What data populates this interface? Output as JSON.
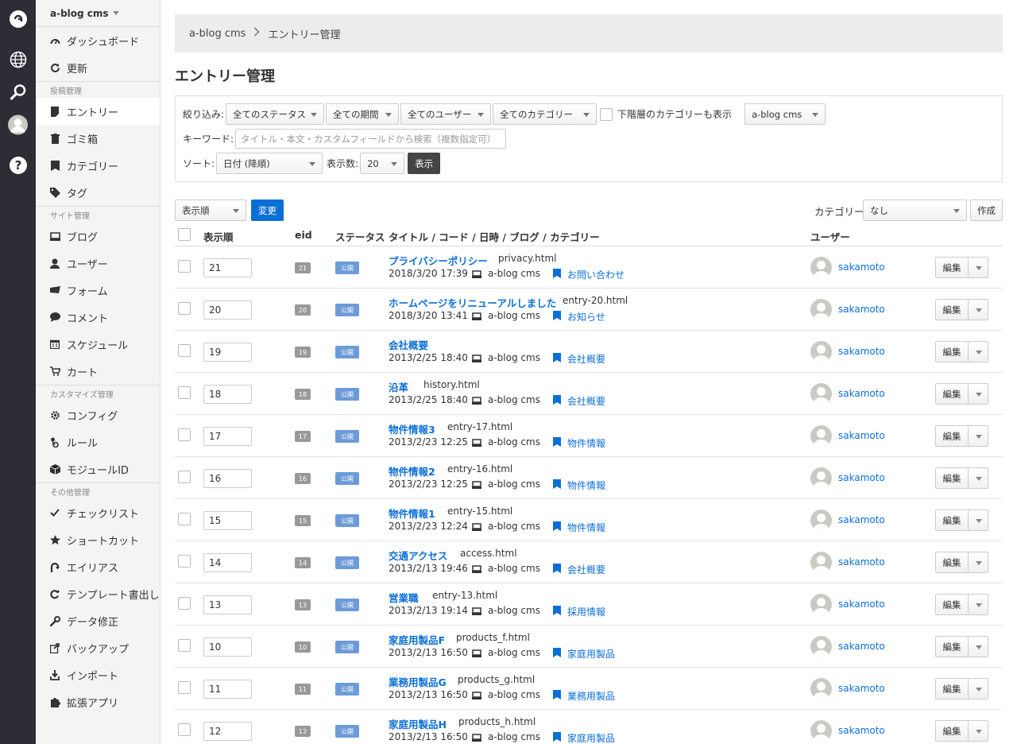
{
  "sidebar": {
    "site_name": "a-blog cms",
    "items_top": [
      {
        "label": "ダッシュボード",
        "icon": "dashboard-icon"
      },
      {
        "label": "更新",
        "icon": "refresh-icon"
      }
    ],
    "sections": [
      {
        "title": "投稿管理",
        "items": [
          {
            "label": "エントリー",
            "icon": "entry-icon",
            "active": true
          },
          {
            "label": "ゴミ箱",
            "icon": "trash-icon"
          },
          {
            "label": "カテゴリー",
            "icon": "category-icon"
          },
          {
            "label": "タグ",
            "icon": "tag-icon"
          }
        ]
      },
      {
        "title": "サイト管理",
        "items": [
          {
            "label": "ブログ",
            "icon": "blog-icon"
          },
          {
            "label": "ユーザー",
            "icon": "user-icon"
          },
          {
            "label": "フォーム",
            "icon": "form-icon"
          },
          {
            "label": "コメント",
            "icon": "comment-icon"
          },
          {
            "label": "スケジュール",
            "icon": "calendar-icon"
          },
          {
            "label": "カート",
            "icon": "cart-icon"
          }
        ]
      },
      {
        "title": "カスタマイズ管理",
        "items": [
          {
            "label": "コンフィグ",
            "icon": "gear-icon"
          },
          {
            "label": "ルール",
            "icon": "rule-icon"
          },
          {
            "label": "モジュールID",
            "icon": "module-icon"
          }
        ]
      },
      {
        "title": "その他管理",
        "items": [
          {
            "label": "チェックリスト",
            "icon": "check-icon"
          },
          {
            "label": "ショートカット",
            "icon": "star-icon"
          },
          {
            "label": "エイリアス",
            "icon": "alias-icon"
          },
          {
            "label": "テンプレート書出し",
            "icon": "template-icon"
          },
          {
            "label": "データ修正",
            "icon": "wrench-icon"
          },
          {
            "label": "バックアップ",
            "icon": "backup-icon"
          },
          {
            "label": "インポート",
            "icon": "import-icon"
          },
          {
            "label": "拡張アプリ",
            "icon": "puzzle-icon"
          }
        ]
      }
    ]
  },
  "breadcrumb": {
    "home": "a-blog cms",
    "current": "エントリー管理"
  },
  "page_title": "エントリー管理",
  "filter": {
    "narrow_label": "絞り込み:",
    "status": "全てのステータス",
    "period": "全ての期間",
    "user": "全てのユーザー",
    "category": "全てのカテゴリー",
    "subcat_label": "下階層のカテゴリーも表示",
    "blog": "a-blog cms",
    "keyword_label": "キーワード:",
    "keyword_placeholder": "タイトル・本文・カスタムフィールドから検索（複数指定可）",
    "sort_label": "ソート:",
    "sort": "日付 (降順)",
    "count_label": "表示数:",
    "count": "20",
    "show_button": "表示"
  },
  "actions": {
    "order_select": "表示順",
    "change_button": "変更",
    "category_label": "カテゴリー",
    "category_select": "なし",
    "create_button": "作成"
  },
  "table": {
    "headers": {
      "order": "表示順",
      "eid": "eid",
      "status": "ステータス",
      "title": "タイトル / コード / 日時 / ブログ / カテゴリー",
      "user": "ユーザー"
    },
    "edit_label": "編集",
    "rows": [
      {
        "order": "21",
        "eid": "21",
        "status": "公開",
        "title": "プライバシーポリシー",
        "code": "privacy.html",
        "date": "2018/3/20 17:39",
        "blog": "a-blog cms",
        "category": "お問い合わせ",
        "user": "sakamoto"
      },
      {
        "order": "20",
        "eid": "20",
        "status": "公開",
        "title": "ホームページをリニューアルしました",
        "code": "entry-20.html",
        "date": "2018/3/20 13:41",
        "blog": "a-blog cms",
        "category": "お知らせ",
        "user": "sakamoto"
      },
      {
        "order": "19",
        "eid": "19",
        "status": "公開",
        "title": "会社概要",
        "code": "",
        "date": "2013/2/25 18:40",
        "blog": "a-blog cms",
        "category": "会社概要",
        "user": "sakamoto"
      },
      {
        "order": "18",
        "eid": "18",
        "status": "公開",
        "title": "沿革",
        "code": "history.html",
        "date": "2013/2/25 18:40",
        "blog": "a-blog cms",
        "category": "会社概要",
        "user": "sakamoto"
      },
      {
        "order": "17",
        "eid": "17",
        "status": "公開",
        "title": "物件情報3",
        "code": "entry-17.html",
        "date": "2013/2/23 12:25",
        "blog": "a-blog cms",
        "category": "物件情報",
        "user": "sakamoto"
      },
      {
        "order": "16",
        "eid": "16",
        "status": "公開",
        "title": "物件情報2",
        "code": "entry-16.html",
        "date": "2013/2/23 12:25",
        "blog": "a-blog cms",
        "category": "物件情報",
        "user": "sakamoto"
      },
      {
        "order": "15",
        "eid": "15",
        "status": "公開",
        "title": "物件情報1",
        "code": "entry-15.html",
        "date": "2013/2/23 12:24",
        "blog": "a-blog cms",
        "category": "物件情報",
        "user": "sakamoto"
      },
      {
        "order": "14",
        "eid": "14",
        "status": "公開",
        "title": "交通アクセス",
        "code": "access.html",
        "date": "2013/2/13 19:46",
        "blog": "a-blog cms",
        "category": "会社概要",
        "user": "sakamoto"
      },
      {
        "order": "13",
        "eid": "13",
        "status": "公開",
        "title": "営業職",
        "code": "entry-13.html",
        "date": "2013/2/13 19:14",
        "blog": "a-blog cms",
        "category": "採用情報",
        "user": "sakamoto"
      },
      {
        "order": "10",
        "eid": "10",
        "status": "公開",
        "title": "家庭用製品F",
        "code": "products_f.html",
        "date": "2013/2/13 16:50",
        "blog": "a-blog cms",
        "category": "家庭用製品",
        "user": "sakamoto"
      },
      {
        "order": "11",
        "eid": "11",
        "status": "公開",
        "title": "業務用製品G",
        "code": "products_g.html",
        "date": "2013/2/13 16:50",
        "blog": "a-blog cms",
        "category": "業務用製品",
        "user": "sakamoto"
      },
      {
        "order": "12",
        "eid": "12",
        "status": "公開",
        "title": "家庭用製品H",
        "code": "products_h.html",
        "date": "2013/2/13 16:50",
        "blog": "a-blog cms",
        "category": "家庭用製品",
        "user": "sakamoto"
      }
    ]
  },
  "rail": {
    "icons": [
      "logo-icon",
      "globe-icon",
      "search-icon",
      "avatar-icon",
      "help-icon"
    ]
  },
  "colors": {
    "accent": "#0b6fd8",
    "rail": "#2d2d35",
    "status": "#6c9bd8"
  }
}
